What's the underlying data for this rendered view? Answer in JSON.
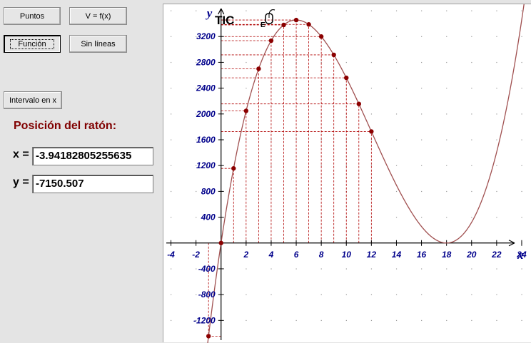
{
  "buttons": {
    "puntos": "Puntos",
    "v_fx": "V = f(x)",
    "funcion": "Función",
    "sin_lineas": "Sin líneas",
    "intervalo": "Intervalo en x"
  },
  "mouse_position": {
    "title": "Posición del ratón:",
    "x_label": "x =",
    "x_value": "-3.94182805255635",
    "y_label": "y =",
    "y_value": "-7150.507"
  },
  "logo": {
    "text": "TIC",
    "sub": "E"
  },
  "colors": {
    "curve": "#a05050",
    "points": "#8b0000",
    "axis": "#000000",
    "ticks": "#00008b",
    "guides": "#b00000",
    "title": "#800000"
  },
  "chart_data": {
    "type": "line",
    "function": "V = 4x^3 - 144x^2 + 1296x",
    "xlabel": "x",
    "ylabel": "y",
    "xlim": [
      -4.6,
      24.8
    ],
    "ylim": [
      -1550,
      3700
    ],
    "x_ticks": [
      -4,
      -2,
      2,
      4,
      6,
      8,
      10,
      12,
      14,
      16,
      18,
      20,
      22,
      24
    ],
    "y_ticks": [
      -1200,
      -800,
      -400,
      400,
      800,
      1200,
      1600,
      2000,
      2400,
      2800,
      3200
    ],
    "curve_x_range": [
      -1.1,
      24.3
    ],
    "points": [
      {
        "x": -1,
        "y": -1444
      },
      {
        "x": 0,
        "y": 0
      },
      {
        "x": 1,
        "y": 1156
      },
      {
        "x": 2,
        "y": 2048
      },
      {
        "x": 3,
        "y": 2700
      },
      {
        "x": 4,
        "y": 3136
      },
      {
        "x": 5,
        "y": 3380
      },
      {
        "x": 6,
        "y": 3456
      },
      {
        "x": 7,
        "y": 3388
      },
      {
        "x": 8,
        "y": 3200
      },
      {
        "x": 9,
        "y": 2916
      },
      {
        "x": 10,
        "y": 2560
      },
      {
        "x": 11,
        "y": 2156
      },
      {
        "x": 12,
        "y": 1728
      }
    ],
    "grid": "dots"
  }
}
